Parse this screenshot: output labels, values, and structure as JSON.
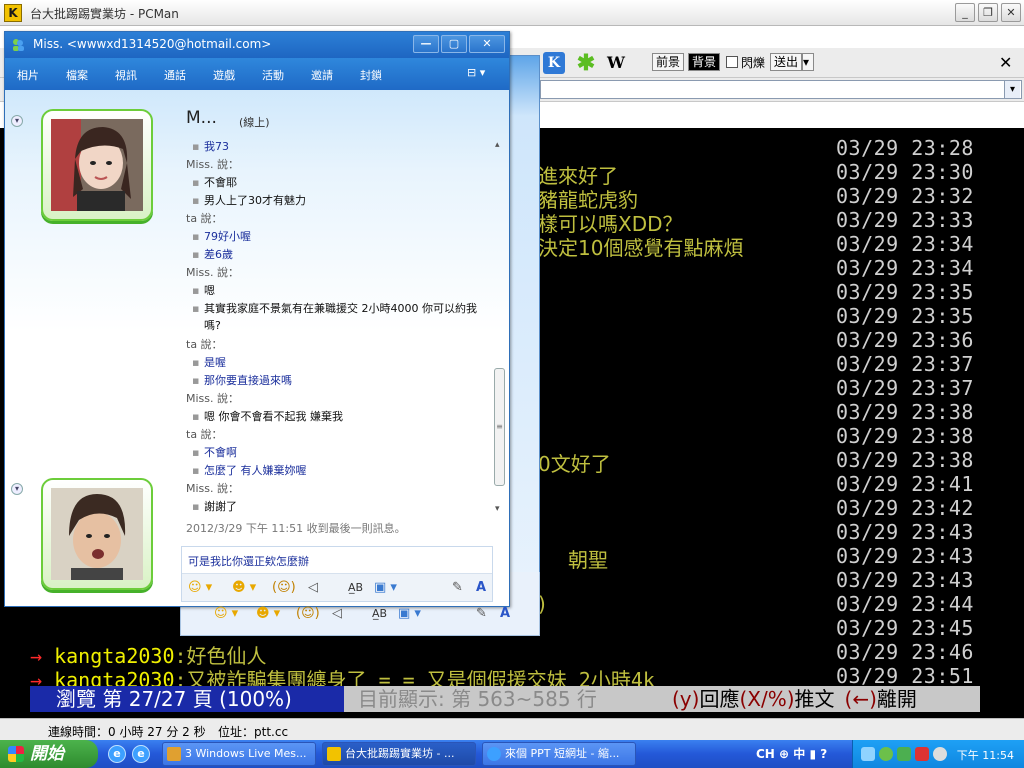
{
  "pcman": {
    "title": "台大批踢踢實業坊 - PCMan",
    "app_icon_glyph": "K",
    "window_controls": {
      "minimize": "_",
      "restore": "❐",
      "close": "✕"
    },
    "toolbar": {
      "w_icon": "W",
      "front_label": "前景",
      "back_label": "背景",
      "blink_label": "閃爍",
      "send_label": "送出",
      "send_drop": "▾",
      "close_glyph": "✕"
    },
    "address_drop": "▾",
    "timestamps": [
      "03/29 23:28",
      "03/29 23:30",
      "03/29 23:32",
      "03/29 23:33",
      "03/29 23:34",
      "03/29 23:34",
      "03/29 23:35",
      "03/29 23:35",
      "03/29 23:36",
      "03/29 23:37",
      "03/29 23:37",
      "03/29 23:38",
      "03/29 23:38",
      "03/29 23:38",
      "03/29 23:41",
      "03/29 23:42",
      "03/29 23:43",
      "03/29 23:43",
      "03/29 23:43",
      "03/29 23:44",
      "03/29 23:45",
      "03/29 23:46",
      "03/29 23:51"
    ],
    "partial_comments": [
      "進來好了",
      "豬龍蛇虎豹",
      "樣可以嗎XDD？",
      "決定10個感覺有點麻煩",
      "0文好了",
      "朝聖",
      ")"
    ],
    "push_lines": [
      {
        "arrow": "→",
        "user": "kangta2030",
        "text": ":好色仙人"
      },
      {
        "arrow": "→",
        "user": "kangta2030",
        "text": ":又被詐騙集團纏身了 = = 又是個假援交妹 2小時4k"
      }
    ],
    "status_browse": "瀏覽 第 27/27 頁 (100%)",
    "status_range": "目前顯示: 第 563~585 行",
    "status_reply_1": "(y)",
    "status_reply_2": "回應",
    "status_reply_3": "(X/%)",
    "status_reply_4": "推文",
    "status_reply_5": "(←)",
    "status_reply_6": "離開",
    "conn_time": "連線時間：0 小時 27 分 2 秒",
    "address": "位址：ptt.cc"
  },
  "msn": {
    "title": "Miss. <wwwxd1314520@hotmail.com>",
    "window_controls": {
      "minimize": "—",
      "maximize": "▢",
      "close": "✕"
    },
    "menu": [
      "相片",
      "檔案",
      "視訊",
      "通話",
      "遊戲",
      "活動",
      "邀請",
      "封鎖"
    ],
    "menu_more": "⊟ ▾",
    "contact_name": "M...",
    "contact_status": "(線上)",
    "bullet": "▪",
    "messages": [
      {
        "type": "me",
        "text": "我73"
      },
      {
        "type": "sender",
        "text": "Miss. 說："
      },
      {
        "type": "her",
        "text": "不會耶"
      },
      {
        "type": "her",
        "text": "男人上了30才有魅力"
      },
      {
        "type": "sender",
        "text": "ta 說："
      },
      {
        "type": "me",
        "text": "79好小喔"
      },
      {
        "type": "me",
        "text": "差6歲"
      },
      {
        "type": "sender",
        "text": "Miss. 說："
      },
      {
        "type": "her",
        "text": "嗯"
      },
      {
        "type": "her",
        "text": "其實我家庭不景氣有在兼職援交 2小時4000 你可以約我嗎?"
      },
      {
        "type": "sender",
        "text": "ta 說："
      },
      {
        "type": "me",
        "text": "是喔"
      },
      {
        "type": "me",
        "text": "那你要直接過來嗎"
      },
      {
        "type": "sender",
        "text": "Miss. 說："
      },
      {
        "type": "her",
        "text": "嗯 你會不會看不起我 嫌棄我"
      },
      {
        "type": "sender",
        "text": "ta 說："
      },
      {
        "type": "me",
        "text": "不會啊"
      },
      {
        "type": "me",
        "text": "怎麼了 有人嫌棄妳喔"
      },
      {
        "type": "sender",
        "text": "Miss. 說："
      },
      {
        "type": "her",
        "text": "謝謝了"
      }
    ],
    "receipt": "2012/3/29 下午 11:51 收到最後一則訊息。",
    "compose_text": "可是我比你還正欸怎麼辦",
    "tools": [
      "☺ ▾",
      "☻ ▾",
      "(☺)",
      "◁",
      "A̲B",
      "▣ ▾",
      "✎",
      "A"
    ]
  },
  "taskbar": {
    "start_label": "開始",
    "quicklaunch": [
      "e",
      "e"
    ],
    "tasks": [
      {
        "label": "3 Windows Live Mes...",
        "color": "#e0a030"
      },
      {
        "label": "台大批踢踢實業坊 - ...",
        "color": "#f2c200"
      },
      {
        "label": "來個 PPT 短網址 - 縮...",
        "color": "#3da0ff"
      }
    ],
    "lang": "CH ⊕ 中 ▮ ?",
    "clock": "下午 11:54"
  }
}
